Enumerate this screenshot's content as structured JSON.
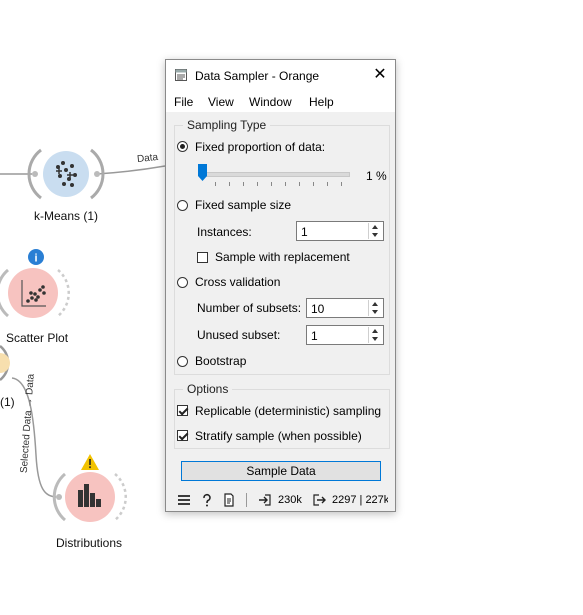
{
  "canvas": {
    "nodes": {
      "kmeans": "k-Means (1)",
      "scatter": "Scatter Plot",
      "distributions": "Distributions",
      "partial": "(1)"
    },
    "links": {
      "data": "Data",
      "selected_data": "Selected Data → Data"
    }
  },
  "dialog": {
    "title": "Data Sampler - Orange",
    "close_glyph": "✕",
    "menu": [
      "File",
      "View",
      "Window",
      "Help"
    ],
    "sampling_type": {
      "title": "Sampling Type",
      "fixed_proportion_label": "Fixed proportion of data:",
      "proportion_value": "1 %",
      "proportion_fraction": 0.01,
      "fixed_size_label": "Fixed sample size",
      "instances_label": "Instances:",
      "instances_value": "1",
      "replacement_label": "Sample with replacement",
      "cross_validation_label": "Cross validation",
      "subsets_label": "Number of subsets:",
      "subsets_value": "10",
      "unused_label": "Unused subset:",
      "unused_value": "1",
      "bootstrap_label": "Bootstrap",
      "selected": "fixed_proportion"
    },
    "options": {
      "title": "Options",
      "replicable_label": "Replicable (deterministic) sampling",
      "replicable_checked": true,
      "stratify_label": "Stratify sample (when possible)",
      "stratify_checked": true
    },
    "action_button": "Sample Data",
    "status": {
      "input_count": "230k",
      "output_count": "2297 | 227k",
      "icons": [
        "menu-icon",
        "help-icon",
        "report-icon",
        "input-icon",
        "output-icon"
      ]
    }
  },
  "colors": {
    "accent": "#0078d7",
    "node_blue": "#c9ddf0",
    "node_pink": "#f7c3c0",
    "info_blue": "#2a7fd4",
    "warning_yellow": "#f2c200"
  }
}
